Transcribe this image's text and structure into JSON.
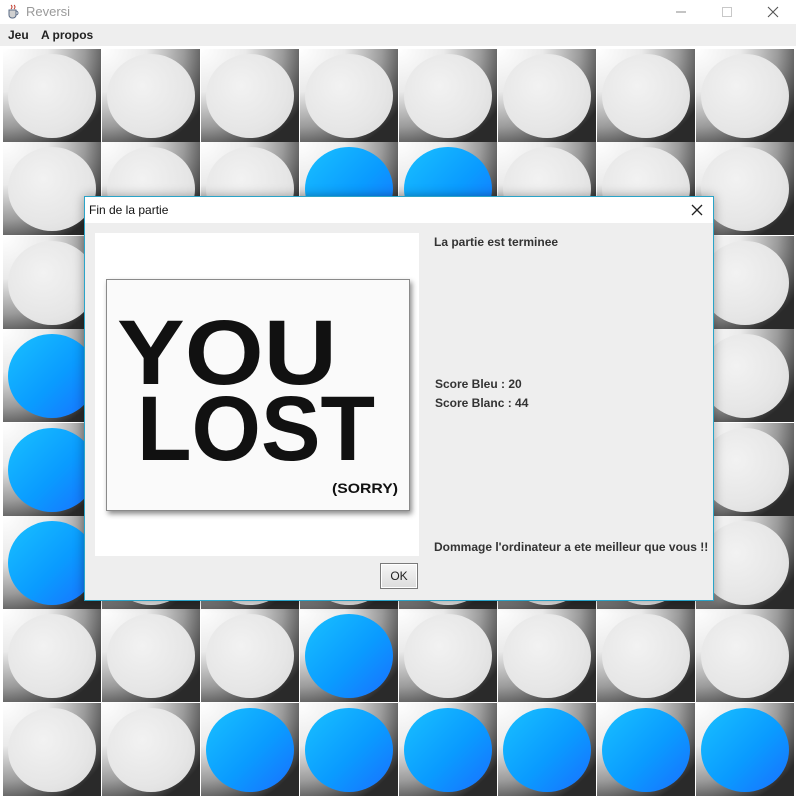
{
  "window": {
    "title": "Reversi",
    "icon": "java-cup-icon"
  },
  "menubar": {
    "items": [
      "Jeu",
      "A propos"
    ]
  },
  "board": {
    "rows": [
      [
        "white",
        "white",
        "white",
        "white",
        "white",
        "white",
        "white",
        "white"
      ],
      [
        "white",
        "white",
        "white",
        "blue",
        "blue",
        "white",
        "white",
        "white"
      ],
      [
        "white",
        "white",
        "white",
        "white",
        "white",
        "white",
        "white",
        "white"
      ],
      [
        "blue",
        "white",
        "white",
        "white",
        "white",
        "white",
        "white",
        "white"
      ],
      [
        "blue",
        "white",
        "white",
        "white",
        "white",
        "white",
        "white",
        "white"
      ],
      [
        "blue",
        "white",
        "white",
        "white",
        "white",
        "white",
        "white",
        "white"
      ],
      [
        "white",
        "white",
        "white",
        "blue",
        "white",
        "white",
        "white",
        "white"
      ],
      [
        "white",
        "white",
        "blue",
        "blue",
        "blue",
        "blue",
        "blue",
        "blue"
      ]
    ],
    "colors": {
      "blue": "#0a9bff",
      "white": "#e6e6e6"
    }
  },
  "dialog": {
    "title": "Fin de la partie",
    "status": "La partie est terminee",
    "score_blue": "Score Bleu : 20",
    "score_white": "Score Blanc : 44",
    "message": "Dommage l'ordinateur a ete meilleur que vous !!",
    "ok_label": "OK",
    "image": {
      "line1": "YOU",
      "line2": "LOST",
      "caption": "(SORRY)"
    }
  },
  "accent_color": "#2aa4c8"
}
